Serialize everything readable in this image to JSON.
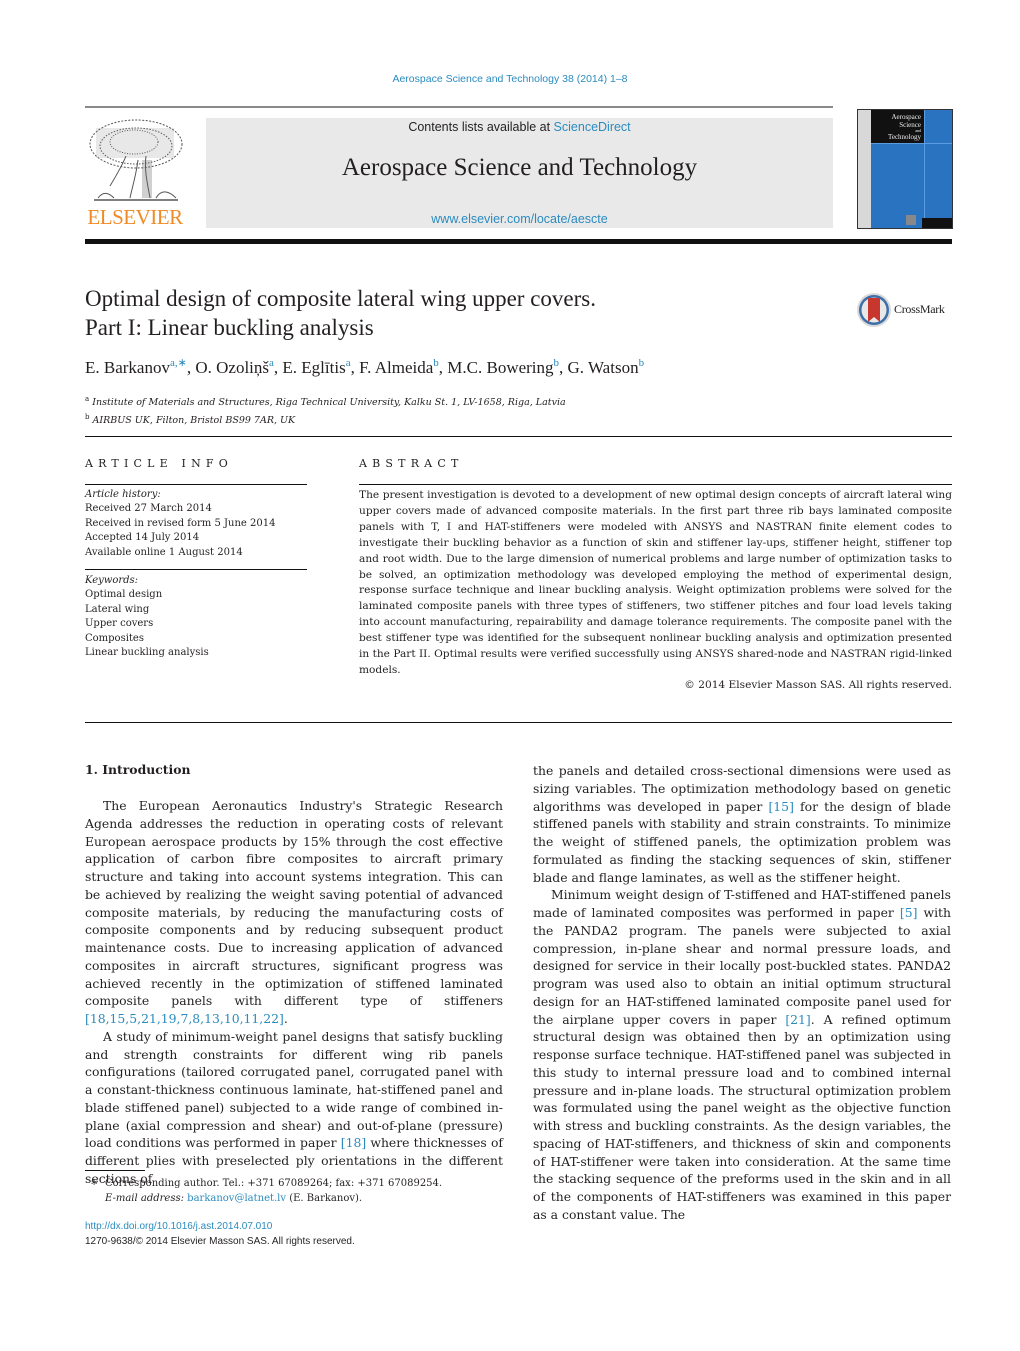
{
  "header": {
    "journal_ref": "Aerospace Science and Technology 38 (2014) 1–8",
    "contents_prefix": "Contents lists available at ",
    "contents_link": "ScienceDirect",
    "journal_title": "Aerospace Science and Technology",
    "journal_url": "www.elsevier.com/locate/aescte",
    "publisher_logo_text": "ELSEVIER",
    "cover_title_lines": [
      "Aerospace",
      "Science",
      "and",
      "Technology"
    ],
    "colors": {
      "link": "#2a8bbf",
      "elsevier_orange": "#f08a24",
      "cover_blue": "#2a73c0"
    }
  },
  "article": {
    "title_line1": "Optimal design of composite lateral wing upper covers.",
    "title_line2": "Part I: Linear buckling analysis",
    "crossmark_label": "CrossMark",
    "authors": [
      {
        "name": "E. Barkanov",
        "aff": "a,∗"
      },
      {
        "name": "O. Ozoliņš",
        "aff": "a"
      },
      {
        "name": "E. Eglītis",
        "aff": "a"
      },
      {
        "name": "F. Almeida",
        "aff": "b"
      },
      {
        "name": "M.C. Bowering",
        "aff": "b"
      },
      {
        "name": "G. Watson",
        "aff": "b"
      }
    ],
    "affiliations": [
      {
        "label": "a",
        "text": "Institute of Materials and Structures, Riga Technical University, Kalku St. 1, LV-1658, Riga, Latvia"
      },
      {
        "label": "b",
        "text": "AIRBUS UK, Filton, Bristol BS99 7AR, UK"
      }
    ]
  },
  "article_info": {
    "heading": "ARTICLE INFO",
    "history_label": "Article history:",
    "history": [
      "Received 27 March 2014",
      "Received in revised form 5 June 2014",
      "Accepted 14 July 2014",
      "Available online 1 August 2014"
    ],
    "keywords_label": "Keywords:",
    "keywords": [
      "Optimal design",
      "Lateral wing",
      "Upper covers",
      "Composites",
      "Linear buckling analysis"
    ]
  },
  "abstract": {
    "heading": "ABSTRACT",
    "text": "The present investigation is devoted to a development of new optimal design concepts of aircraft lateral wing upper covers made of advanced composite materials. In the first part three rib bays laminated composite panels with T, I and HAT-stiffeners were modeled with ANSYS and NASTRAN finite element codes to investigate their buckling behavior as a function of skin and stiffener lay-ups, stiffener height, stiffener top and root width. Due to the large dimension of numerical problems and large number of optimization tasks to be solved, an optimization methodology was developed employing the method of experimental design, response surface technique and linear buckling analysis. Weight optimization problems were solved for the laminated composite panels with three types of stiffeners, two stiffener pitches and four load levels taking into account manufacturing, repairability and damage tolerance requirements. The composite panel with the best stiffener type was identified for the subsequent nonlinear buckling analysis and optimization presented in the Part II. Optimal results were verified successfully using ANSYS shared-node and NASTRAN rigid-linked models.",
    "copyright": "© 2014 Elsevier Masson SAS. All rights reserved."
  },
  "body": {
    "section_heading": "1. Introduction",
    "left": {
      "p1": "The European Aeronautics Industry's Strategic Research Agenda addresses the reduction in operating costs of relevant European aerospace products by 15% through the cost effective application of carbon fibre composites to aircraft primary structure and taking into account systems integration. This can be achieved by realizing the weight saving potential of advanced composite materials, by reducing the manufacturing costs of composite components and by reducing subsequent product maintenance costs. Due to increasing application of advanced composites in aircraft structures, significant progress was achieved recently in the optimization of stiffened laminated composite panels with different type of stiffeners ",
      "p1_cite": "[18,15,5,21,19,7,8,13,10,11,22]",
      "p1_end": ".",
      "p2_a": "A study of minimum-weight panel designs that satisfy buckling and strength constraints for different wing rib panels configurations (tailored corrugated panel, corrugated panel with a constant-thickness continuous laminate, hat-stiffened panel and blade stiffened panel) subjected to a wide range of combined in-plane (axial compression and shear) and out-of-plane (pressure) load conditions was performed in paper ",
      "p2_cite": "[18]",
      "p2_b": " where thicknesses of different plies with preselected ply orientations in the different sections of"
    },
    "right": {
      "p1_a": "the panels and detailed cross-sectional dimensions were used as sizing variables. The optimization methodology based on genetic algorithms was developed in paper ",
      "p1_cite": "[15]",
      "p1_b": " for the design of blade stiffened panels with stability and strain constraints. To minimize the weight of stiffened panels, the optimization problem was formulated as finding the stacking sequences of skin, stiffener blade and flange laminates, as well as the stiffener height.",
      "p2_a": "Minimum weight design of T-stiffened and HAT-stiffened panels made of laminated composites was performed in paper ",
      "p2_cite1": "[5]",
      "p2_b": " with the PANDA2 program. The panels were subjected to axial compression, in-plane shear and normal pressure loads, and designed for service in their locally post-buckled states. PANDA2 program was used also to obtain an initial optimum structural design for an HAT-stiffened laminated composite panel used for the airplane upper covers in paper ",
      "p2_cite2": "[21]",
      "p2_c": ". A refined optimum structural design was obtained then by an optimization using response surface technique. HAT-stiffened panel was subjected in this study to internal pressure load and to combined internal pressure and in-plane loads. The structural optimization problem was formulated using the panel weight as the objective function with stress and buckling constraints. As the design variables, the spacing of HAT-stiffeners, and thickness of skin and components of HAT-stiffener were taken into consideration. At the same time the stacking sequence of the preforms used in the skin and in all of the components of HAT-stiffeners was examined in this paper as a constant value. The"
    }
  },
  "footnote": {
    "symbol": "∗",
    "line1": "Corresponding author. Tel.: +371 67089264; fax: +371 67089254.",
    "email_label": "E-mail address: ",
    "email": "barkanov@latnet.lv",
    "email_suffix": " (E. Barkanov).",
    "doi": "http://dx.doi.org/10.1016/j.ast.2014.07.010",
    "issn_line": "1270-9638/© 2014 Elsevier Masson SAS. All rights reserved."
  }
}
